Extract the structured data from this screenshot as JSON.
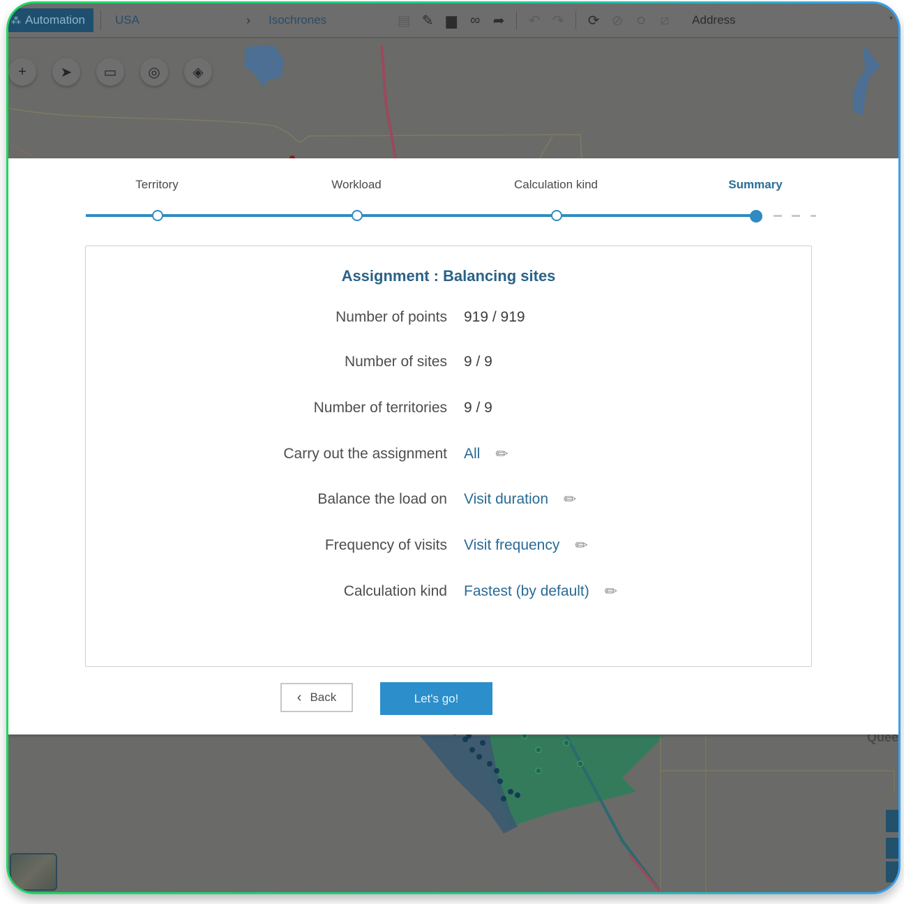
{
  "toolbar": {
    "automation_label": "Automation",
    "automation_icon": "wand-icon",
    "breadcrumb": [
      "USA",
      "Isochrones"
    ],
    "breadcrumb_separator": "›",
    "tools": [
      {
        "name": "save-icon",
        "glyph": "▤",
        "enabled": false
      },
      {
        "name": "save-as-icon",
        "glyph": "✎",
        "enabled": true
      },
      {
        "name": "folder-icon",
        "glyph": "▆",
        "enabled": true
      },
      {
        "name": "link-icon",
        "glyph": "∞",
        "enabled": true
      },
      {
        "name": "share-icon",
        "glyph": "➦",
        "enabled": true
      },
      {
        "name": "undo-icon",
        "glyph": "↶",
        "enabled": false
      },
      {
        "name": "redo-icon",
        "glyph": "↷",
        "enabled": false
      },
      {
        "name": "add-shape-icon",
        "glyph": "⟳",
        "enabled": true
      },
      {
        "name": "cancel-icon",
        "glyph": "⊘",
        "enabled": false
      },
      {
        "name": "lasso-icon",
        "glyph": "◌",
        "enabled": true
      },
      {
        "name": "no-select-icon",
        "glyph": "⧄",
        "enabled": false
      }
    ],
    "address_label": "Address",
    "address_caret": "▾"
  },
  "map": {
    "controls": [
      {
        "name": "add-icon",
        "glyph": "+"
      },
      {
        "name": "pointer-icon",
        "glyph": "➤"
      },
      {
        "name": "comment-icon",
        "glyph": "▭"
      },
      {
        "name": "analysis-icon",
        "glyph": "◎"
      },
      {
        "name": "layers-icon",
        "glyph": "◈"
      }
    ],
    "place_label": "Quee"
  },
  "wizard": {
    "steps": [
      {
        "label": "Territory",
        "state": "done"
      },
      {
        "label": "Workload",
        "state": "done"
      },
      {
        "label": "Calculation kind",
        "state": "done"
      },
      {
        "label": "Summary",
        "state": "active"
      }
    ],
    "title": "Assignment : Balancing sites",
    "rows": [
      {
        "label": "Number of points",
        "value": "919 / 919",
        "editable": false
      },
      {
        "label": "Number of sites",
        "value": "9 / 9",
        "editable": false
      },
      {
        "label": "Number of territories",
        "value": "9 / 9",
        "editable": false
      },
      {
        "label": "Carry out the assignment",
        "value": "All",
        "editable": true
      },
      {
        "label": "Balance the load on",
        "value": "Visit duration",
        "editable": true
      },
      {
        "label": "Frequency of visits",
        "value": "Visit frequency",
        "editable": true
      },
      {
        "label": "Calculation kind",
        "value": "Fastest (by default)",
        "editable": true
      }
    ],
    "back_label": "Back",
    "back_icon": "‹",
    "go_label": "Let's go!",
    "edit_glyph": "✏"
  },
  "colors": {
    "accent": "#2c8ecb",
    "title": "#2a6288",
    "link": "#2a6a96",
    "automation_bg": "#1f4f6e"
  }
}
